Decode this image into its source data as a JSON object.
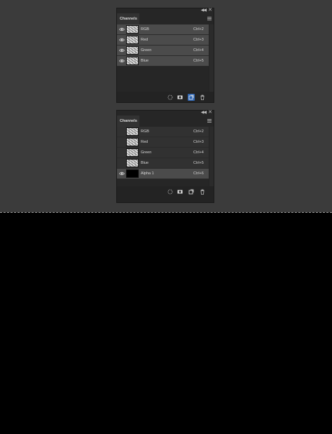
{
  "panels": [
    {
      "tab_label": "Channels",
      "channels": [
        {
          "name": "RGB",
          "shortcut": "Ctrl+2",
          "visible": true,
          "selected": true,
          "thumbnail": "texture"
        },
        {
          "name": "Red",
          "shortcut": "Ctrl+3",
          "visible": true,
          "selected": true,
          "thumbnail": "texture"
        },
        {
          "name": "Green",
          "shortcut": "Ctrl+4",
          "visible": true,
          "selected": true,
          "thumbnail": "texture"
        },
        {
          "name": "Blue",
          "shortcut": "Ctrl+5",
          "visible": true,
          "selected": true,
          "thumbnail": "texture"
        }
      ],
      "toolbar": {
        "icons": [
          "load-selection-icon",
          "save-selection-icon",
          "new-channel-icon",
          "delete-channel-icon"
        ],
        "highlighted": "new-channel-icon"
      }
    },
    {
      "tab_label": "Channels",
      "channels": [
        {
          "name": "RGB",
          "shortcut": "Ctrl+2",
          "visible": false,
          "selected": false,
          "thumbnail": "texture"
        },
        {
          "name": "Red",
          "shortcut": "Ctrl+3",
          "visible": false,
          "selected": false,
          "thumbnail": "texture"
        },
        {
          "name": "Green",
          "shortcut": "Ctrl+4",
          "visible": false,
          "selected": false,
          "thumbnail": "texture"
        },
        {
          "name": "Blue",
          "shortcut": "Ctrl+5",
          "visible": false,
          "selected": false,
          "thumbnail": "texture"
        },
        {
          "name": "Alpha 1",
          "shortcut": "Ctrl+6",
          "visible": true,
          "selected": true,
          "thumbnail": "black"
        }
      ],
      "toolbar": {
        "icons": [
          "load-selection-icon",
          "save-selection-icon",
          "new-channel-icon",
          "delete-channel-icon"
        ],
        "highlighted": ""
      }
    }
  ],
  "colors": {
    "workspace_bg": "#3b3b3b",
    "panel_bg": "#232323",
    "row_selected": "#4b4b4b",
    "row_unselected": "#313131",
    "highlight_button": "#2f66b3",
    "lower_canvas": "#000000"
  }
}
